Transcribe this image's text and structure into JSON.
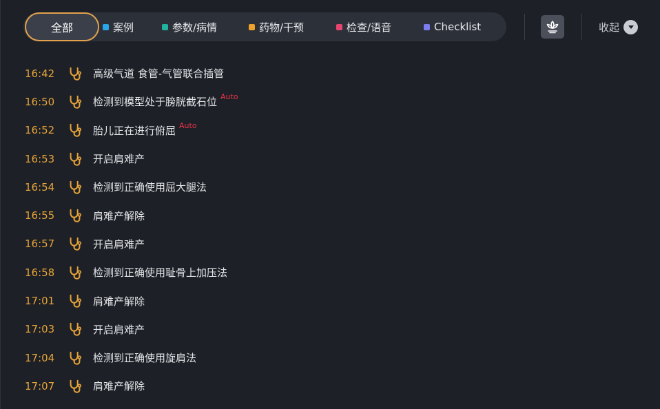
{
  "filters": {
    "all_label": "全部",
    "items": [
      {
        "label": "案例",
        "color": "#2aa6e8"
      },
      {
        "label": "参数/病情",
        "color": "#20b3a0"
      },
      {
        "label": "药物/干预",
        "color": "#f0a12a"
      },
      {
        "label": "检查/语音",
        "color": "#e8436f"
      },
      {
        "label": "Checklist",
        "color": "#7c7cf0"
      }
    ]
  },
  "toolbar": {
    "collapse_label": "收起"
  },
  "accent_time_color": "#e6a43a",
  "auto_tag_color": "#e8334a",
  "log": [
    {
      "time": "16:42",
      "text": "高级气道  食管-气管联合插管",
      "auto": ""
    },
    {
      "time": "16:50",
      "text": "检测到模型处于膀胱截石位",
      "auto": "Auto"
    },
    {
      "time": "16:52",
      "text": "胎儿正在进行俯屈",
      "auto": "Auto"
    },
    {
      "time": "16:53",
      "text": "开启肩难产",
      "auto": ""
    },
    {
      "time": "16:54",
      "text": "检测到正确使用屈大腿法",
      "auto": ""
    },
    {
      "time": "16:55",
      "text": "肩难产解除",
      "auto": ""
    },
    {
      "time": "16:57",
      "text": "开启肩难产",
      "auto": ""
    },
    {
      "time": "16:58",
      "text": "检测到正确使用耻骨上加压法",
      "auto": ""
    },
    {
      "time": "17:01",
      "text": "肩难产解除",
      "auto": ""
    },
    {
      "time": "17:03",
      "text": "开启肩难产",
      "auto": ""
    },
    {
      "time": "17:04",
      "text": "检测到正确使用旋肩法",
      "auto": ""
    },
    {
      "time": "17:07",
      "text": "肩难产解除",
      "auto": ""
    }
  ]
}
